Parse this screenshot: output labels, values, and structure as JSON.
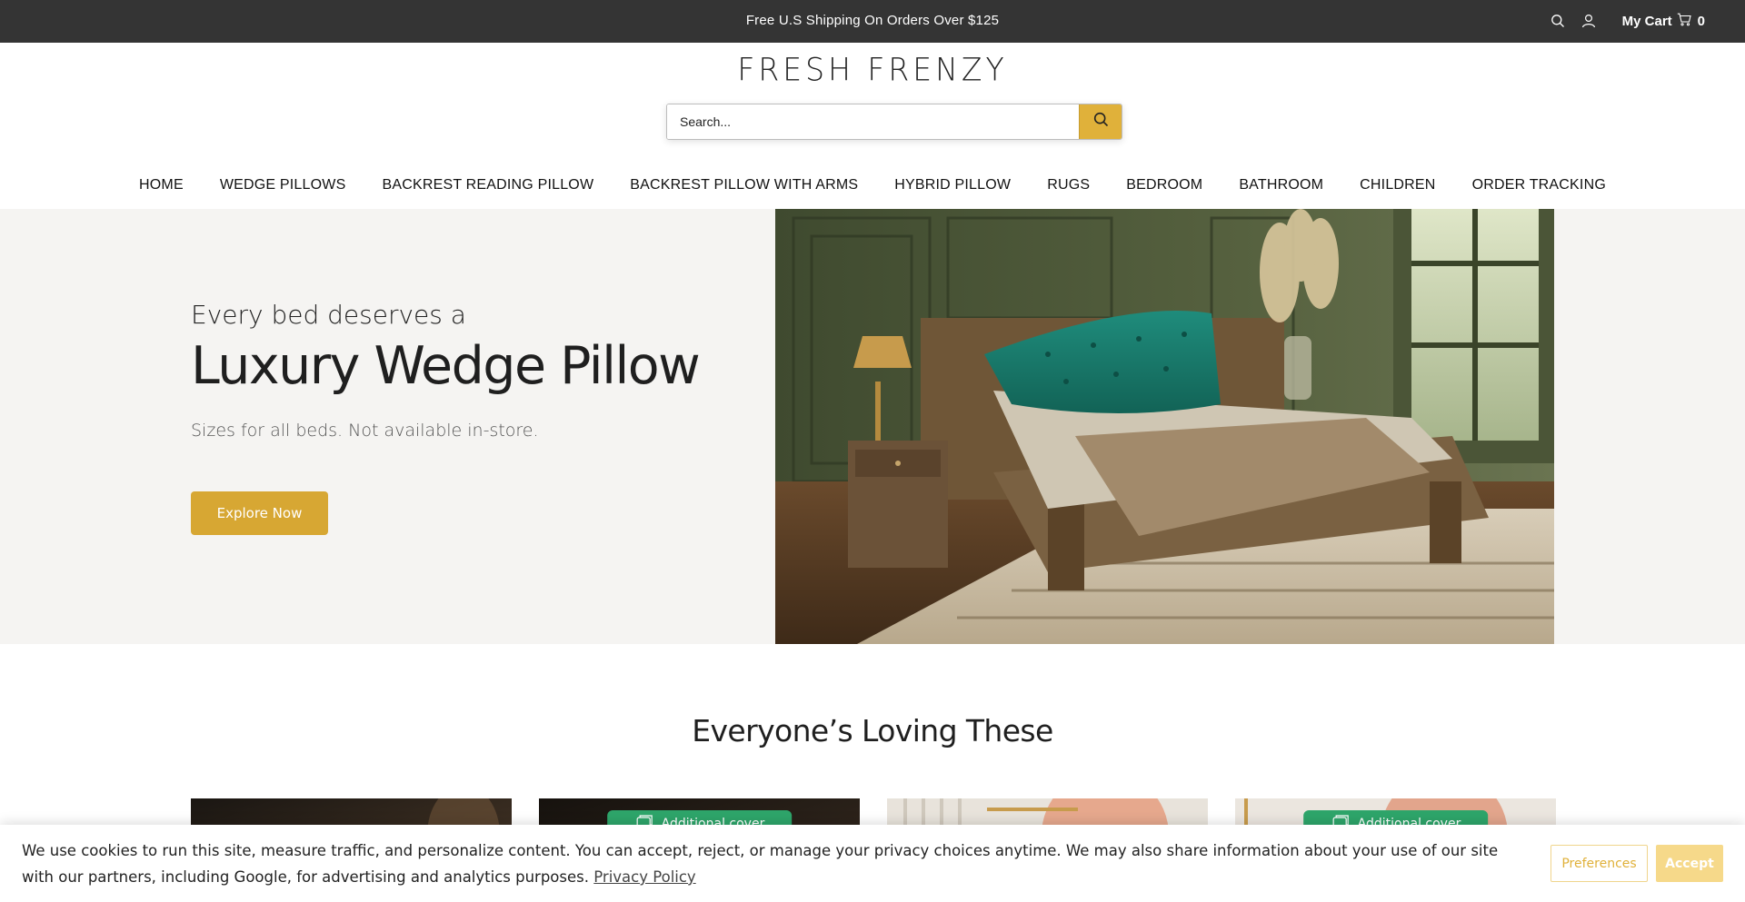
{
  "announcement": {
    "text": "Free U.S Shipping On Orders Over $125"
  },
  "topbar": {
    "search_icon": "search-icon",
    "account_icon": "user-icon",
    "cart_label": "My Cart",
    "cart_icon": "cart-icon",
    "cart_count": "0"
  },
  "header": {
    "logo": "FRESH FRENZY",
    "search": {
      "placeholder": "Search...",
      "button_icon": "search-icon"
    }
  },
  "nav": {
    "items": [
      {
        "label": "HOME"
      },
      {
        "label": "WEDGE PILLOWS"
      },
      {
        "label": "BACKREST READING PILLOW"
      },
      {
        "label": "BACKREST PILLOW WITH ARMS"
      },
      {
        "label": "HYBRID PILLOW"
      },
      {
        "label": "RUGS"
      },
      {
        "label": "BEDROOM"
      },
      {
        "label": "BATHROOM"
      },
      {
        "label": "CHILDREN"
      },
      {
        "label": "ORDER TRACKING"
      }
    ]
  },
  "hero": {
    "eyebrow": "Every bed deserves a",
    "headline": "Luxury Wedge Pillow",
    "sub": "Sizes for all beds. Not available in-store.",
    "cta": "Explore Now"
  },
  "section": {
    "title": "Everyone’s Loving These",
    "products": [
      {
        "badge": ""
      },
      {
        "badge": "Additional cover"
      },
      {
        "badge": ""
      },
      {
        "badge": "Additional cover"
      }
    ]
  },
  "cookie": {
    "message": "We use cookies to run this site, measure traffic, and personalize content. You can accept, reject, or manage your privacy choices anytime. We may also share information about your use of our site with our partners, including Google, for advertising and analytics purposes.",
    "privacy_link": "Privacy Policy",
    "preferences": "Preferences",
    "accept": "Accept"
  },
  "colors": {
    "topbar_bg": "#343434",
    "accent": "#e0b13a",
    "cta": "#d7a733",
    "badge_green": "#2ea56a",
    "hero_bg": "#f5f4f2"
  }
}
